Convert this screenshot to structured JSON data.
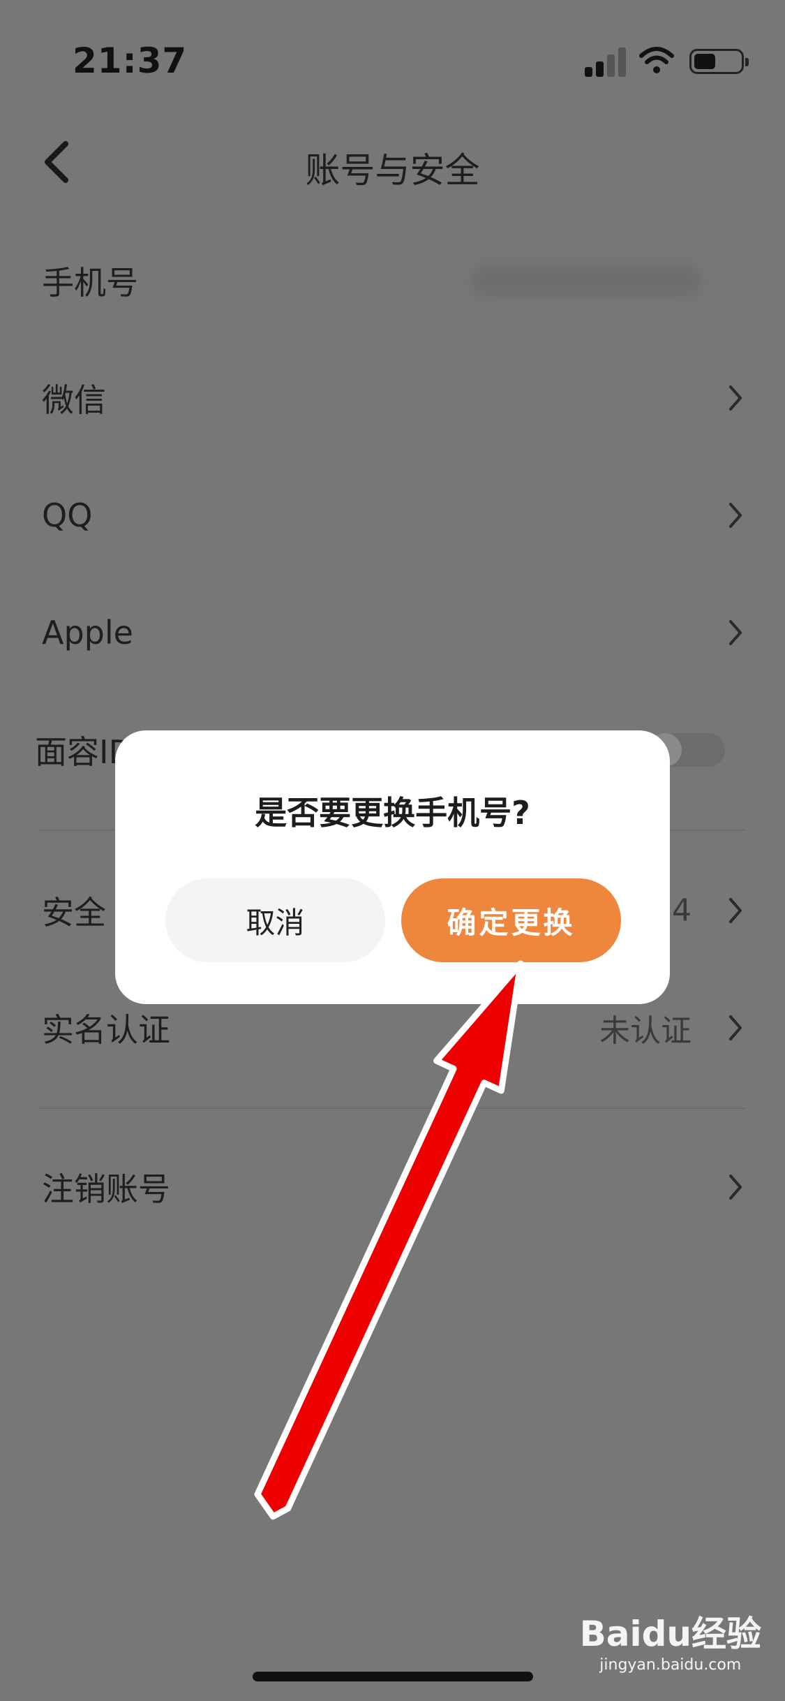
{
  "status_bar": {
    "time": "21:37",
    "icons": [
      "cellular-signal-icon",
      "wifi-icon",
      "battery-icon"
    ]
  },
  "nav": {
    "back_icon": "chevron-left-icon",
    "title": "账号与安全"
  },
  "rows": [
    {
      "label": "手机号",
      "value": ""
    },
    {
      "label": "微信",
      "value": ""
    },
    {
      "label": "QQ",
      "value": ""
    },
    {
      "label": "Apple",
      "value": ""
    },
    {
      "label": "面容ID",
      "value": ""
    },
    {
      "label": "安全",
      "value": "4"
    },
    {
      "label": "实名认证",
      "value": "未认证"
    },
    {
      "label": "注销账号",
      "value": ""
    }
  ],
  "dialog": {
    "title": "是否要更换手机号?",
    "cancel_label": "取消",
    "confirm_label": "确定更换"
  },
  "watermark": {
    "brand": "Baidu经验",
    "site": "jingyan.baidu.com"
  },
  "colors": {
    "accent": "#ee873d",
    "overlay": "#777777",
    "arrow": "#ee0000"
  }
}
